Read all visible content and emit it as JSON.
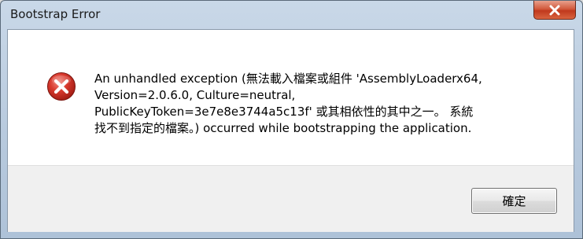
{
  "window": {
    "title": "Bootstrap Error"
  },
  "dialog": {
    "icon": "error-icon",
    "message": "An unhandled exception (無法載入檔案或組件 'AssemblyLoaderx64,\nVersion=2.0.6.0, Culture=neutral,\nPublicKeyToken=3e7e8e3744a5c13f' 或其相依性的其中之一。 系統\n找不到指定的檔案。) occurred while bootstrapping the application.",
    "ok_label": "確定"
  },
  "colors": {
    "title_bar": "#b7c9dd",
    "close_button": "#c0391d",
    "error_red": "#d32f2f",
    "footer": "#f0f0f0"
  }
}
